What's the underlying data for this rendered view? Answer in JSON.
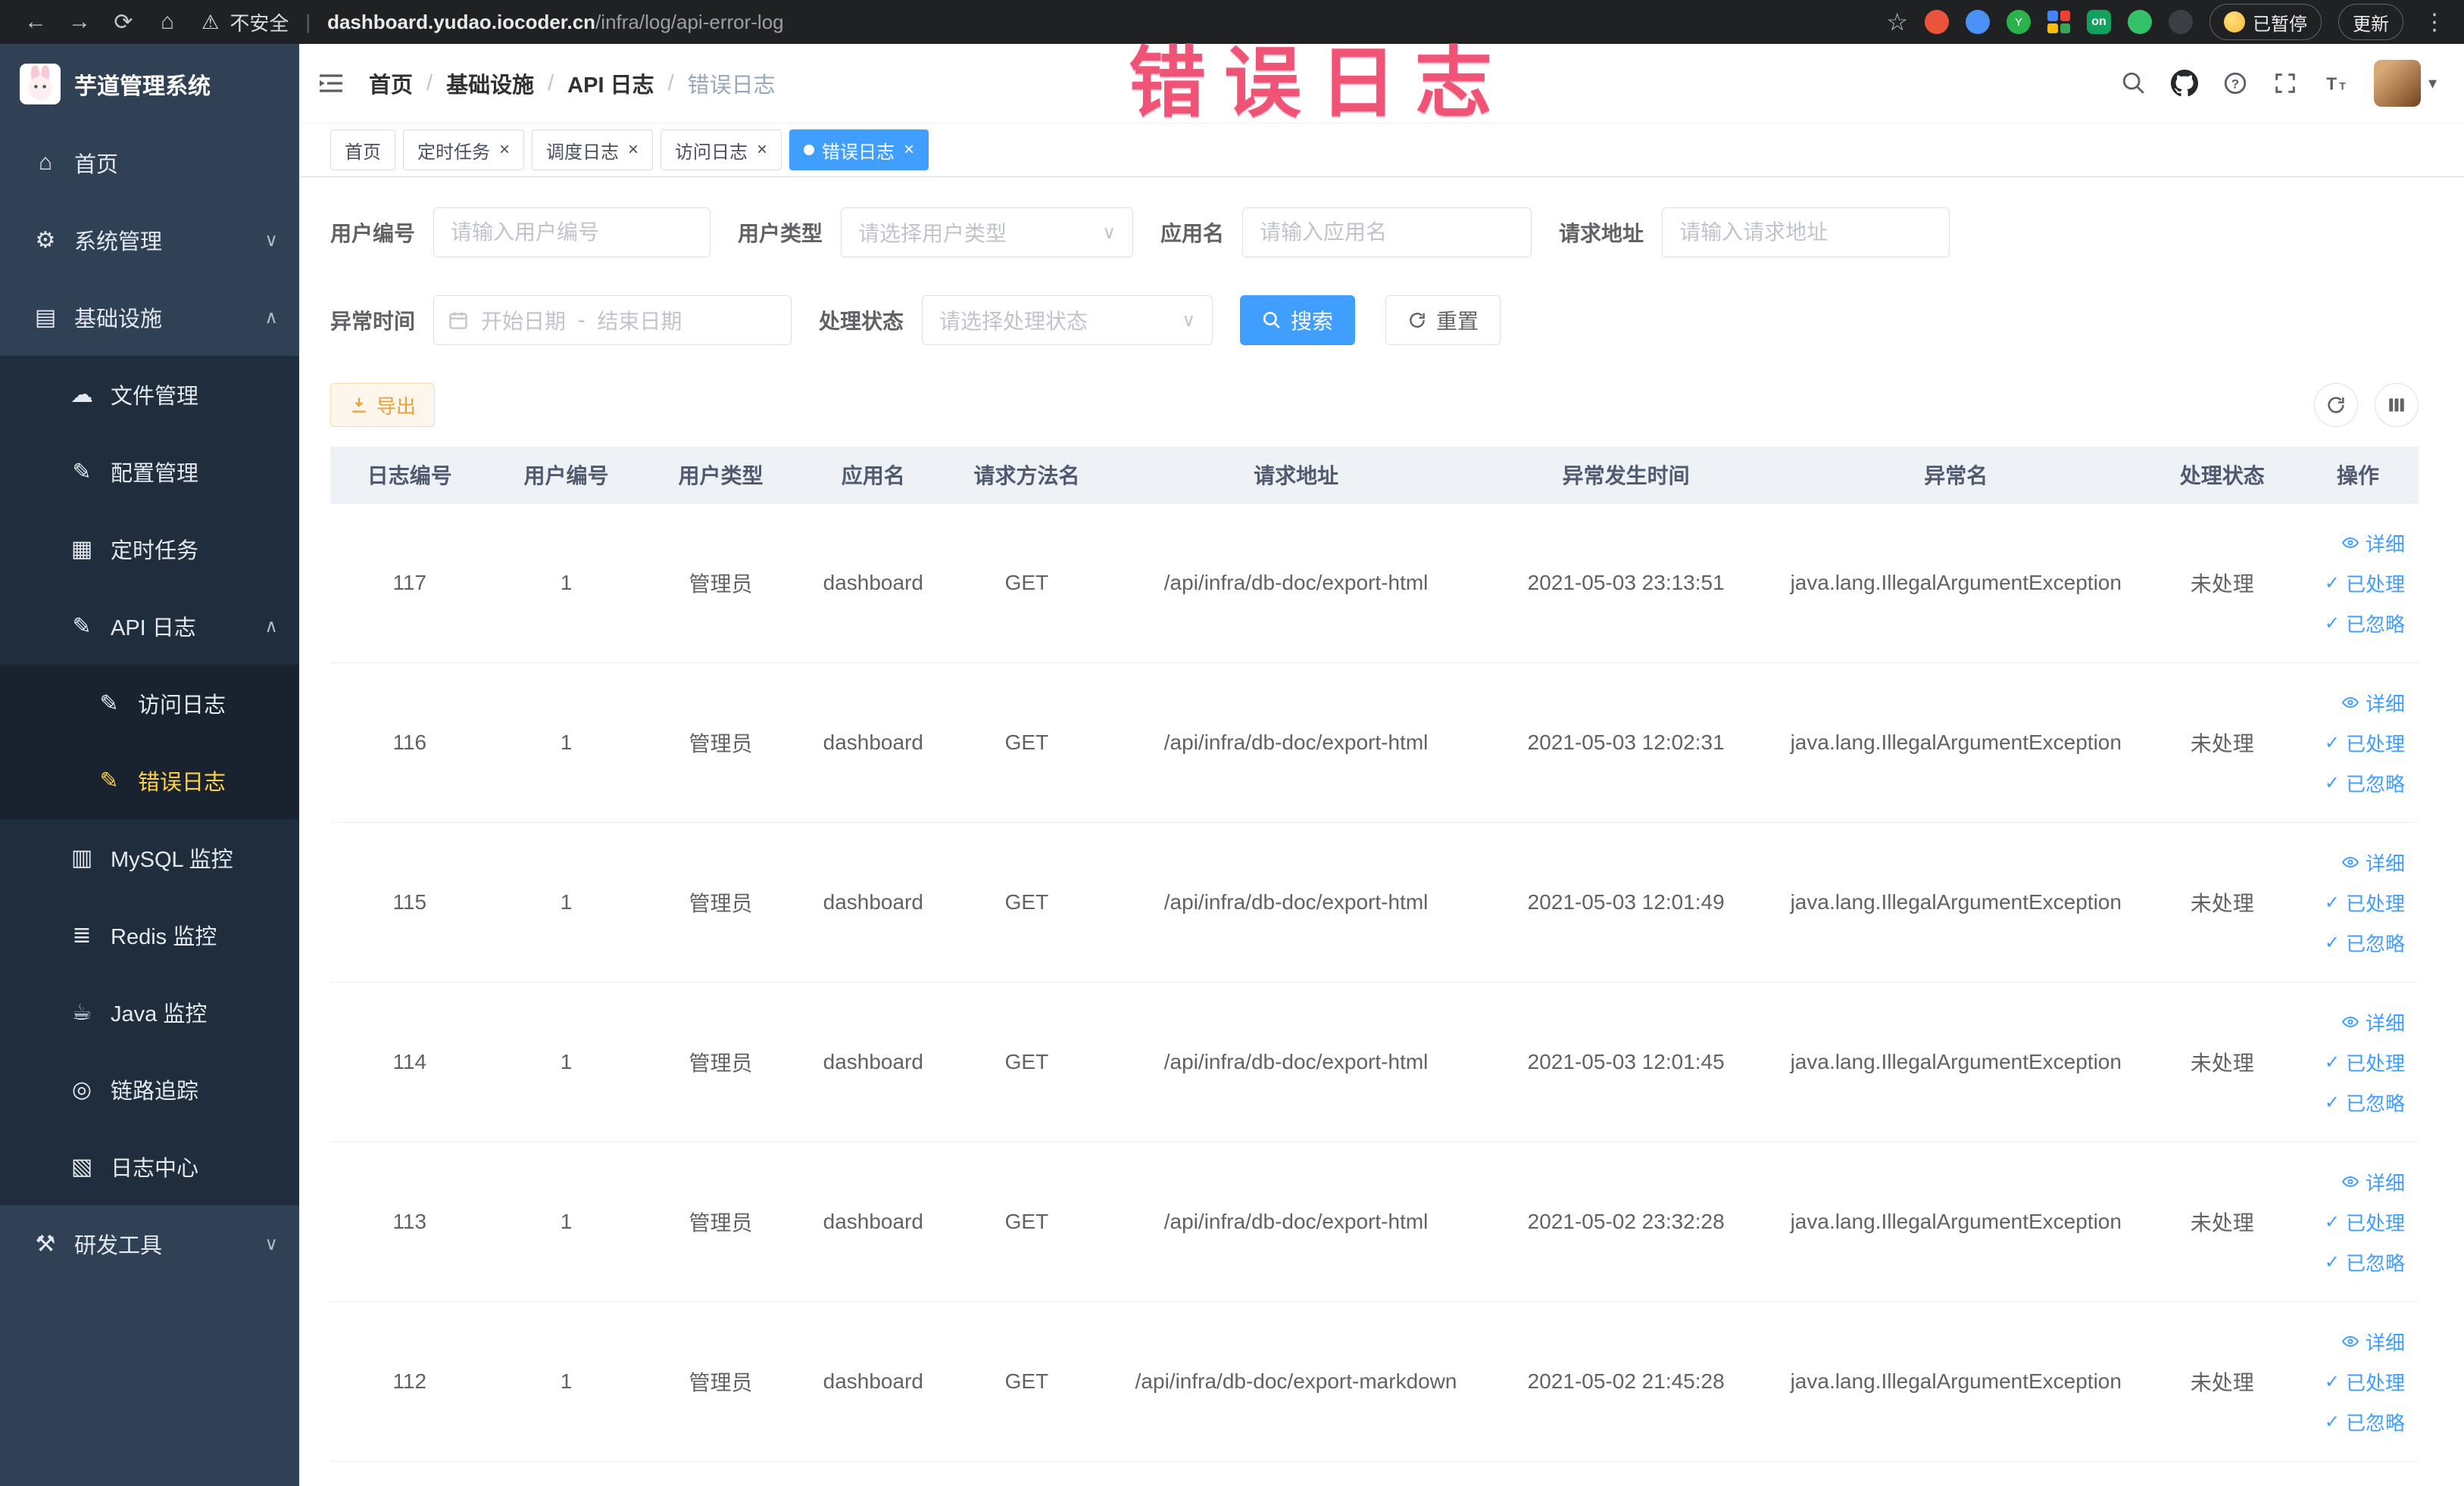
{
  "browser": {
    "security_label": "不安全",
    "url_host": "dashboard.yudao.iocoder.cn",
    "url_path": "/infra/log/api-error-log",
    "ext_on_label": "on",
    "paused_badge": "已暂停",
    "update_button": "更新"
  },
  "annotation": {
    "text": "错误日志",
    "color": "#ee4a6e"
  },
  "sidebar": {
    "logo_title": "芋道管理系统",
    "items": [
      {
        "label": "首页"
      },
      {
        "label": "系统管理",
        "expanded": false
      },
      {
        "label": "基础设施",
        "expanded": true
      },
      {
        "label": "文件管理"
      },
      {
        "label": "配置管理"
      },
      {
        "label": "定时任务"
      },
      {
        "label": "API 日志",
        "expanded": true
      },
      {
        "label": "访问日志"
      },
      {
        "label": "错误日志",
        "active": true
      },
      {
        "label": "MySQL 监控"
      },
      {
        "label": "Redis 监控"
      },
      {
        "label": "Java 监控"
      },
      {
        "label": "链路追踪"
      },
      {
        "label": "日志中心"
      },
      {
        "label": "研发工具",
        "expanded": false
      }
    ]
  },
  "breadcrumb": {
    "items": [
      "首页",
      "基础设施",
      "API 日志",
      "错误日志"
    ]
  },
  "tabs": [
    {
      "label": "首页",
      "closable": false,
      "active": false
    },
    {
      "label": "定时任务",
      "closable": true,
      "active": false
    },
    {
      "label": "调度日志",
      "closable": true,
      "active": false
    },
    {
      "label": "访问日志",
      "closable": true,
      "active": false
    },
    {
      "label": "错误日志",
      "closable": true,
      "active": true
    }
  ],
  "filters": {
    "user_id": {
      "label": "用户编号",
      "placeholder": "请输入用户编号"
    },
    "user_type": {
      "label": "用户类型",
      "placeholder": "请选择用户类型"
    },
    "app_name": {
      "label": "应用名",
      "placeholder": "请输入应用名"
    },
    "request_url": {
      "label": "请求地址",
      "placeholder": "请输入请求地址"
    },
    "exception_time": {
      "label": "异常时间",
      "start_placeholder": "开始日期",
      "separator": "-",
      "end_placeholder": "结束日期"
    },
    "process_status": {
      "label": "处理状态",
      "placeholder": "请选择处理状态"
    },
    "search_button": "搜索",
    "reset_button": "重置"
  },
  "toolbar": {
    "export_button": "导出"
  },
  "table": {
    "columns": [
      "日志编号",
      "用户编号",
      "用户类型",
      "应用名",
      "请求方法名",
      "请求地址",
      "异常发生时间",
      "异常名",
      "处理状态",
      "操作"
    ],
    "rows": [
      {
        "id": "117",
        "user_id": "1",
        "user_type": "管理员",
        "app": "dashboard",
        "method": "GET",
        "url": "/api/infra/db-doc/export-html",
        "time": "2021-05-03 23:13:51",
        "exception": "java.lang.IllegalArgumentException",
        "status": "未处理",
        "actions": {
          "detail": "详细",
          "processed": "已处理",
          "ignored": "已忽略"
        }
      },
      {
        "id": "116",
        "user_id": "1",
        "user_type": "管理员",
        "app": "dashboard",
        "method": "GET",
        "url": "/api/infra/db-doc/export-html",
        "time": "2021-05-03 12:02:31",
        "exception": "java.lang.IllegalArgumentException",
        "status": "未处理",
        "actions": {
          "detail": "详细",
          "processed": "已处理",
          "ignored": "已忽略"
        }
      },
      {
        "id": "115",
        "user_id": "1",
        "user_type": "管理员",
        "app": "dashboard",
        "method": "GET",
        "url": "/api/infra/db-doc/export-html",
        "time": "2021-05-03 12:01:49",
        "exception": "java.lang.IllegalArgumentException",
        "status": "未处理",
        "actions": {
          "detail": "详细",
          "processed": "已处理",
          "ignored": "已忽略"
        }
      },
      {
        "id": "114",
        "user_id": "1",
        "user_type": "管理员",
        "app": "dashboard",
        "method": "GET",
        "url": "/api/infra/db-doc/export-html",
        "time": "2021-05-03 12:01:45",
        "exception": "java.lang.IllegalArgumentException",
        "status": "未处理",
        "actions": {
          "detail": "详细",
          "processed": "已处理",
          "ignored": "已忽略"
        }
      },
      {
        "id": "113",
        "user_id": "1",
        "user_type": "管理员",
        "app": "dashboard",
        "method": "GET",
        "url": "/api/infra/db-doc/export-html",
        "time": "2021-05-02 23:32:28",
        "exception": "java.lang.IllegalArgumentException",
        "status": "未处理",
        "actions": {
          "detail": "详细",
          "processed": "已处理",
          "ignored": "已忽略"
        }
      },
      {
        "id": "112",
        "user_id": "1",
        "user_type": "管理员",
        "app": "dashboard",
        "method": "GET",
        "url": "/api/infra/db-doc/export-markdown",
        "time": "2021-05-02 21:45:28",
        "exception": "java.lang.IllegalArgumentException",
        "status": "未处理",
        "actions": {
          "detail": "详细",
          "processed": "已处理",
          "ignored": "已忽略"
        }
      }
    ]
  }
}
